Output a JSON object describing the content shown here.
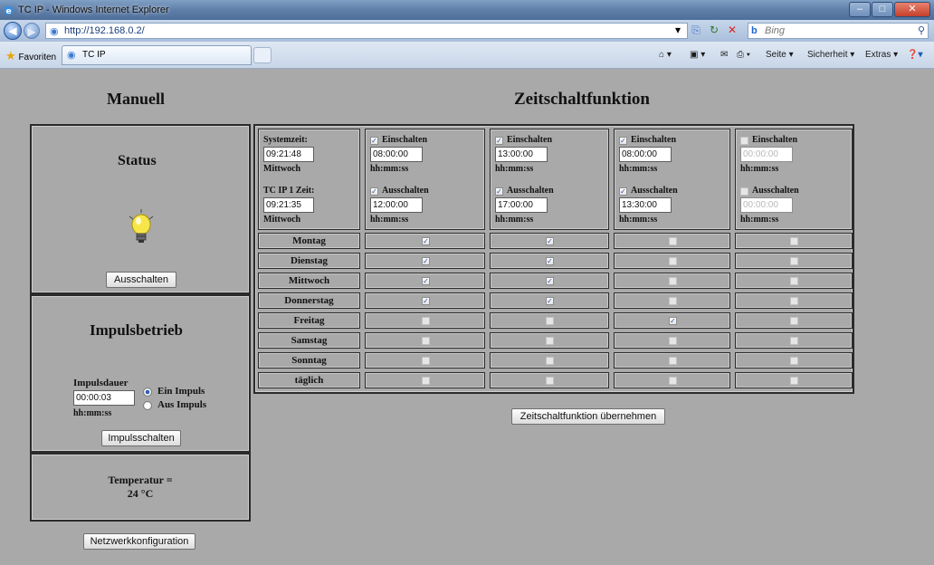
{
  "window": {
    "title": "TC IP - Windows Internet Explorer",
    "url": "http://192.168.0.2/",
    "search_placeholder": "Bing",
    "search_provider": "Bing"
  },
  "favbar": {
    "favorites_label": "Favoriten",
    "tab_label": "TC IP",
    "seite_label": "Seite ▾",
    "sicherheit_label": "Sicherheit ▾",
    "extras_label": "Extras ▾"
  },
  "manual": {
    "heading": "Manuell",
    "status_heading": "Status",
    "lamp_state": "on",
    "switch_button": "Ausschalten",
    "impuls_heading": "Impulsbetrieb",
    "impulsdauer_label": "Impulsdauer",
    "impulsdauer_value": "00:00:03",
    "impulsdauer_format": "hh:mm:ss",
    "radio_ein": "Ein Impuls",
    "radio_aus": "Aus Impuls",
    "impuls_button": "Impulsschalten",
    "temperature_label": "Temperatur =",
    "temperature_value": "24 °C",
    "network_button": "Netzwerkkonfiguration"
  },
  "timer": {
    "heading": "Zeitschaltfunktion",
    "systemzeit_label": "Systemzeit:",
    "systemzeit_value": "09:21:48",
    "systemzeit_day": "Mittwoch",
    "tcip_label": "TC IP 1 Zeit:",
    "tcip_value": "09:21:35",
    "tcip_day": "Mittwoch",
    "on_label": "Einschalten",
    "off_label": "Ausschalten",
    "format": "hh:mm:ss",
    "slots": [
      {
        "on_enabled": true,
        "on_time": "08:00:00",
        "off_enabled": true,
        "off_time": "12:00:00"
      },
      {
        "on_enabled": true,
        "on_time": "13:00:00",
        "off_enabled": true,
        "off_time": "17:00:00"
      },
      {
        "on_enabled": true,
        "on_time": "08:00:00",
        "off_enabled": true,
        "off_time": "13:30:00"
      },
      {
        "on_enabled": false,
        "on_time": "00:00:00",
        "off_enabled": false,
        "off_time": "00:00:00"
      }
    ],
    "days": [
      "Montag",
      "Dienstag",
      "Mittwoch",
      "Donnerstag",
      "Freitag",
      "Samstag",
      "Sonntag",
      "täglich"
    ],
    "day_matrix": [
      [
        true,
        true,
        false,
        false
      ],
      [
        true,
        true,
        false,
        false
      ],
      [
        true,
        true,
        false,
        false
      ],
      [
        true,
        true,
        false,
        false
      ],
      [
        false,
        false,
        true,
        false
      ],
      [
        false,
        false,
        false,
        false
      ],
      [
        false,
        false,
        false,
        false
      ],
      [
        false,
        false,
        false,
        false
      ]
    ],
    "apply_button": "Zeitschaltfunktion übernehmen"
  }
}
